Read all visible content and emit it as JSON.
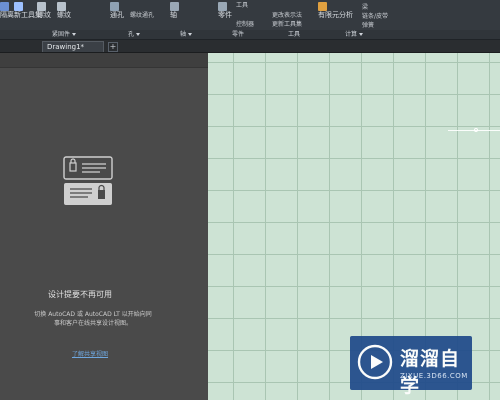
{
  "ribbon": {
    "top_items": [
      {
        "name": "ribbon-item-1",
        "label": "隔离",
        "icon": "shape-icon",
        "color": "#6b8fd3"
      },
      {
        "name": "ribbon-item-2",
        "label": "新工具集",
        "icon": "toolset-icon",
        "color": "#9dc0ff"
      },
      {
        "name": "ribbon-item-3",
        "label": "螺纹",
        "icon": "thread-icon",
        "color": "#b8c2cc"
      },
      {
        "name": "ribbon-item-4",
        "label": "螺纹",
        "icon": "thread-icon",
        "color": "#b8c2cc"
      },
      {
        "name": "ribbon-item-5",
        "label": "通孔",
        "icon": "hole-icon",
        "color": "#8fa1b3"
      },
      {
        "name": "ribbon-item-6",
        "label": "螺纹通孔",
        "icon": "threaded-hole-icon",
        "color": "#8fa1b3"
      },
      {
        "name": "ribbon-item-7",
        "label": "轴",
        "icon": "shaft-icon",
        "color": "#9aa8b6"
      },
      {
        "name": "ribbon-item-8",
        "label": "零件",
        "icon": "part-icon",
        "color": "#9aa8b6"
      },
      {
        "name": "ribbon-item-9",
        "label": "工具",
        "icon": "tool-icon",
        "color": "#9aa8b6"
      },
      {
        "name": "ribbon-item-10",
        "label": "更改表示法",
        "icon": "change-icon",
        "color": "#9aa8b6"
      },
      {
        "name": "ribbon-item-11",
        "label": "控制器",
        "icon": "controller-icon",
        "color": "#9aa8b6"
      },
      {
        "name": "ribbon-item-12",
        "label": "更新工具集",
        "icon": "update-icon",
        "color": "#9aa8b6"
      },
      {
        "name": "ribbon-item-13",
        "label": "有限元分析",
        "icon": "fea-icon",
        "color": "#e0a040"
      },
      {
        "name": "ribbon-item-14",
        "label": "梁",
        "icon": "beam-icon",
        "color": "#9aa8b6"
      },
      {
        "name": "ribbon-item-15",
        "label": "链条/皮带",
        "icon": "chain-icon",
        "color": "#9aa8b6"
      },
      {
        "name": "ribbon-item-16",
        "label": "弹簧",
        "icon": "spring-icon",
        "color": "#9aa8b6"
      }
    ],
    "panels": [
      {
        "name": "panel-label-parts",
        "label": "紧固件"
      },
      {
        "name": "panel-label-holes",
        "label": "孔"
      },
      {
        "name": "panel-label-shafts",
        "label": "轴"
      },
      {
        "name": "panel-label-parts2",
        "label": "零件"
      },
      {
        "name": "panel-label-tools",
        "label": "工具"
      },
      {
        "name": "panel-label-calc",
        "label": "计算"
      }
    ]
  },
  "tabs": [
    {
      "label": "Drawing1*"
    }
  ],
  "design_feed": {
    "title": "设计提要不再可用",
    "body": "切换 AutoCAD 或 AutoCAD LT 以开始向同事和客户在线共享设计视图。",
    "link": "了解共享视图"
  },
  "watermark": {
    "name": "溜溜自学",
    "url": "ZIXUE.3D66.COM",
    "color": "#1f4a8a"
  }
}
